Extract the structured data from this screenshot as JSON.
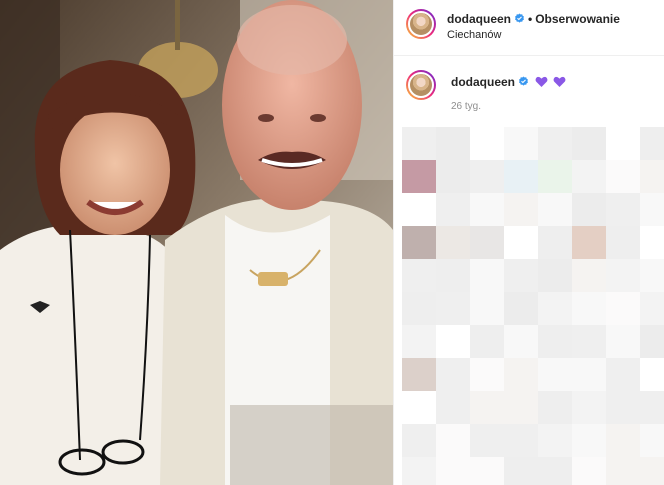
{
  "post": {
    "username": "dodaqueen",
    "follow_label": "Obserwowanie",
    "separator": "•",
    "location": "Ciechanów"
  },
  "caption": {
    "username": "dodaqueen",
    "emoji": [
      "purple-heart",
      "purple-heart"
    ],
    "time": "26 tyg."
  },
  "colors": {
    "verified": "#3897f0",
    "heart": "#8a58e6",
    "border": "#efefef",
    "muted": "#8e8e8e"
  }
}
